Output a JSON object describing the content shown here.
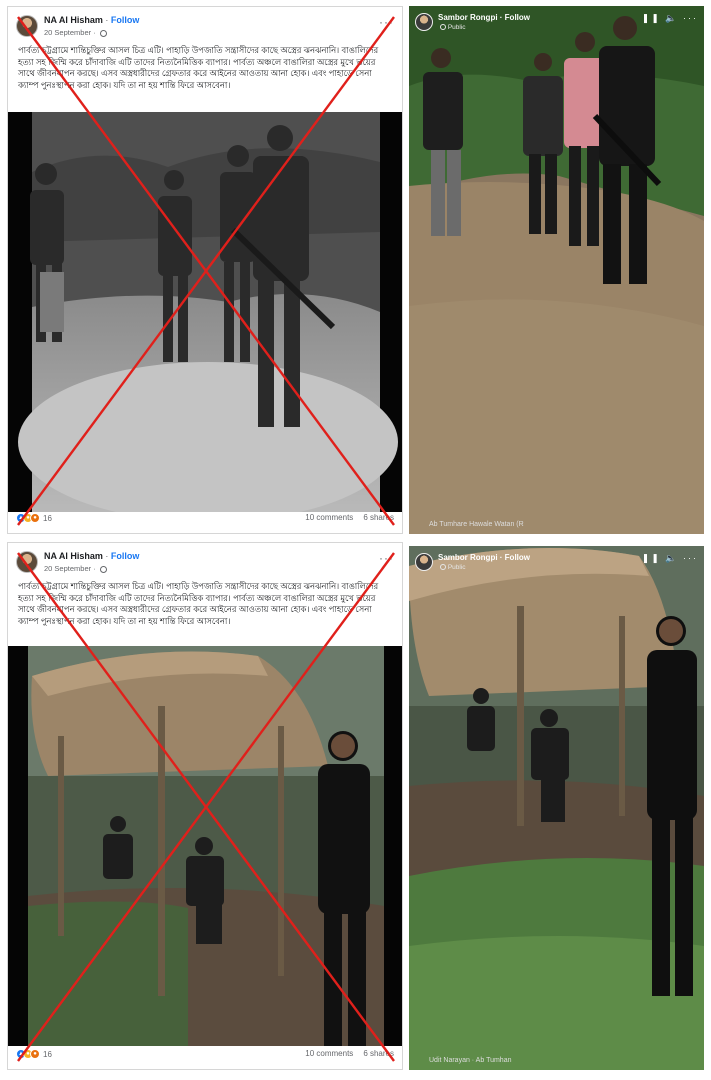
{
  "posts": [
    {
      "author": "NA Al Hisham",
      "separator": " · ",
      "follow": "Follow",
      "date": "20 September · ",
      "text": "পার্বত্য চট্টগ্রামে শান্তিচুক্তির আসল চিত্র এটি। পাহাড়ি উপজাতি সন্ত্রাসীদের কাছে অস্ত্রের ঝনঝনানি। বাঙালিদের হত্যা সহ জিম্মি করে চাঁদাবাজি এটি তাদের নিত্যনৈমিত্তিক ব্যাপার। পার্বত্য অঞ্চলে বাঙালিরা অস্ত্রের মুখে ভয়ের সাথে জীবনযাপন করছে। এসব অস্ত্রধারীদের গ্রেফতার করে আইনের আওতায় আনা হোক। এবং পাহাড়ে সেনা ক্যাম্প পুনঃস্থাপন করা হোক। যদি তা না হয় শান্তি ফিরে আসবেনা।",
      "reaction_count": "16",
      "comments": "10 comments",
      "shares": "6 shares"
    },
    {
      "author": "NA Al Hisham",
      "separator": " · ",
      "follow": "Follow",
      "date": "20 September · ",
      "text": "পার্বত্য চট্টগ্রামে শান্তিচুক্তির আসল চিত্র এটি। পাহাড়ি উপজাতি সন্ত্রাসীদের কাছে অস্ত্রের ঝনঝনানি। বাঙালিদের হত্যা সহ জিম্মি করে চাঁদাবাজি এটি তাদের নিত্যনৈমিত্তিক ব্যাপার। পার্বত্য অঞ্চলে বাঙালিরা অস্ত্রের মুখে ভয়ের সাথে জীবনযাপন করছে। এসব অস্ত্রধারীদের গ্রেফতার করে আইনের আওতায় আনা হোক। এবং পাহাড়ে সেনা ক্যাম্প পুনঃস্থাপন করা হোক। যদি তা না হয় শান্তি ফিরে আসবেনা।",
      "reaction_count": "16",
      "comments": "10 comments",
      "shares": "6 shares"
    }
  ],
  "videos": [
    {
      "author": "Sambor Rongpi",
      "separator": " · ",
      "follow": "Follow",
      "visibility": "Public",
      "caption": "Ab Tumhare Hawale Watan (R"
    },
    {
      "author": "Sambor Rongpi",
      "separator": " · ",
      "follow": "Follow",
      "visibility": "Public",
      "caption": "Udit Narayan · Ab Tumhan"
    }
  ],
  "icons": {
    "more": "more-options-icon",
    "globe": "globe-icon",
    "pause": "pause-icon",
    "volume": "volume-icon"
  },
  "colors": {
    "fake_mark": "#e0201b",
    "follow": "#1877f2",
    "like": "#1877f2",
    "wow": "#f7b125"
  }
}
